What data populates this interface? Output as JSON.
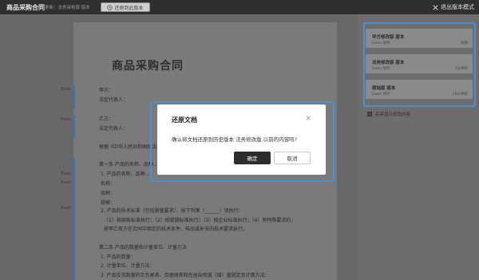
{
  "topbar": {
    "title": "商品采购合同",
    "subtitle": "更新：法务审核版 版本",
    "restore_label": "还原到此版本",
    "exit_label": "退出版本模式"
  },
  "document": {
    "title": "商品采购合同",
    "margin_label": "Ewen",
    "lines": [
      "甲方：",
      "法定代表人：",
      "乙方：",
      "法定代表人：",
      "根据《中华人民共和国民法典》...",
      "第一条 产品的名称、品种...",
      "1. 产品的名称、品种...",
      "名称：",
      "品种：",
      "规格：",
      "2. 产品的技术标准（包括质量要求），按下列第（______）项执行：",
      "（1）按国家标准执行；（2）按部颁标准执行；（3）按企业标准执行；（4）有特殊要求的，",
      "按甲乙双方在合同中商定的技术条件、样品或补充的技术要求执行。",
      "第二条 产品的数量和计量单位、计量方法",
      "1. 产品的数量：",
      "2. 计量单位、计量方法：",
      "3. 产品交货数量的正负尾差、合理磅差和在途自然减（增）量规定及计算方法："
    ]
  },
  "panel": {
    "versions": [
      {
        "name": "甲方修改版 版本",
        "meta": "Ewen  保存",
        "time": "刚刚"
      },
      {
        "name": "法务修改版 版本",
        "meta": "Ewen  保存",
        "time": "2分钟前"
      },
      {
        "name": "原始版 版本",
        "meta": "Ewen  保存",
        "time": "28分钟前"
      }
    ],
    "checkbox_label": "高亮显示修改内容"
  },
  "modal": {
    "title": "还原文档",
    "message": "确认将文档还原到历史版本 法务修改版 以前的内容吗?",
    "ok_label": "确定",
    "cancel_label": "取消",
    "close_icon": "close-icon"
  },
  "colors": {
    "accent": "#4a90d2",
    "topbar": "#2f2f2f",
    "primary_button": "#2d2d2d"
  }
}
